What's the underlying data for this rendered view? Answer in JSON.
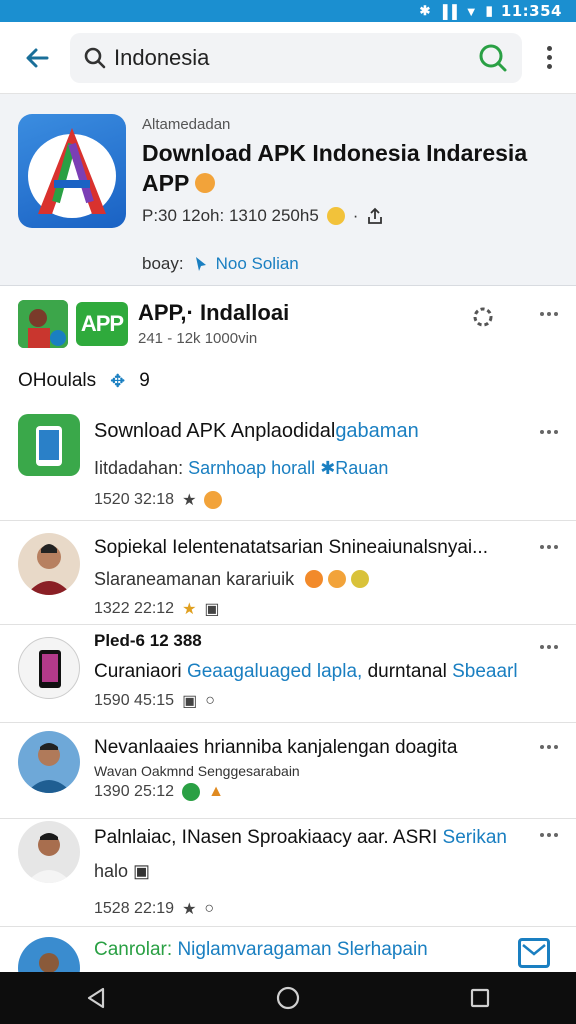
{
  "status_bar": {
    "time": "11:354"
  },
  "search": {
    "query": "Indonesia"
  },
  "feature": {
    "small_label": "Altamedadan",
    "title": "Download APK Indonesia Indaresia APP",
    "meta": "P:30 12oh: 1310 250h5",
    "link_prefix": "boay:",
    "link_text": "Noo Solian"
  },
  "section": {
    "app_badge": "APP",
    "title": "APP,· Indalloai",
    "subtitle": "241 - 12k 1000vin"
  },
  "filter": {
    "label": "OHoulals",
    "count": "9"
  },
  "posts": [
    {
      "title": "Sownload APK Anplaodidal",
      "title_link": "gabaman",
      "sub": "Iitdadahan:",
      "sub_link": "Sarnhoap horall",
      "sub_link2": "Rauan",
      "time": "1520 32:18"
    },
    {
      "title": "Sopiekal Ielentenatatsarian Snineaiunalsnyai...",
      "sub": "Slaraneamanan karariuik",
      "time": "1322 22:12"
    },
    {
      "head": "Pled-6 12 388",
      "title": "Curaniaori",
      "title_link": "Geaagaluaged lapla,",
      "title_tail": "durntanal",
      "title_link2": "Sbeaarl",
      "time": "1590 45:15"
    },
    {
      "title": "Nevanlaaies hrianniba kanjalengan doagita",
      "sub": "Wavan Oakmnd Senggesarabain",
      "time": "1390 25:12"
    },
    {
      "title": "Palnlaiac, INasen Sproakiaacy aar. ASRI",
      "title_link": "Serikan",
      "sub": "halo",
      "time": "1528 22:19"
    },
    {
      "title": "Canrolar:",
      "title_link": "Niglamvaragaman Slerhapain"
    }
  ],
  "colors": {
    "accent": "#1a7fc1",
    "status_bar": "#1b8fd0",
    "nav_bar": "#0d0d0d",
    "green": "#2faa3c"
  }
}
